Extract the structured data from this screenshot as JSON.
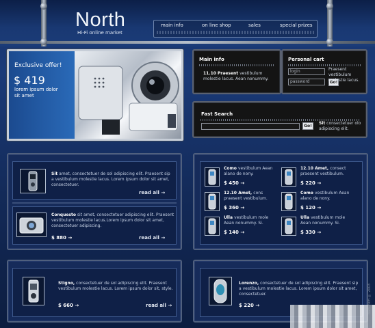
{
  "header": {
    "logo": "North",
    "tagline": "Hi-Fi online market",
    "nav": [
      "main info",
      "on line shop",
      "sales",
      "special prizes"
    ]
  },
  "offer": {
    "title": "Exclusive offer!",
    "price": "$ 419",
    "text": "lorem ipsum dolor sit amet"
  },
  "main_info": {
    "heading": "Main info",
    "date": "11.10",
    "strong": "Praesent",
    "text": "vestibulum molestie lacus. Aean nonummy."
  },
  "cart": {
    "heading": "Personal cart",
    "login_placeholder": "login",
    "password_placeholder": "password",
    "go": "Go!",
    "text": "Praesent vestibulum molestie lacus."
  },
  "search": {
    "heading": "Fast Search",
    "go": "Go!",
    "strong": "Sit",
    "text": "consectetuer olo adipiscing elit."
  },
  "left_products": [
    {
      "strong": "Sit",
      "text": "amet, consectetuer de sol adipiscing elit. Praesent sip a vestibulum molestie lacus. Lorem ipsum dolor sit amet, consectetuer.",
      "link": "read all"
    },
    {
      "strong": "Conquesto",
      "text": "sit amet, consectetuer adipiscing elit. Praesent vestibulum molestie lacus.Lorem ipsum dolor sit amet, consectetuer adipiscing.",
      "price": "$ 880",
      "link": "read all"
    }
  ],
  "phones": [
    {
      "title": "Como",
      "rest": "vestibulum Aean alano de nony.",
      "price": "$ 450"
    },
    {
      "title": "12.10 Amet,",
      "rest": "consect praesent vestibulum.",
      "price": "$ 220"
    },
    {
      "title": "12.10 Amet,",
      "rest": "cons praesent vestibulum.",
      "price": "$ 360"
    },
    {
      "title": "Como",
      "rest": "vestibulum Aean alano de nony.",
      "price": "$ 120"
    },
    {
      "title": "Ulla",
      "rest": "vestibulum mole Aean nonummy. Si.",
      "price": "$ 140"
    },
    {
      "title": "Ulla",
      "rest": "vestibulum mole Aean nonummy. Si.",
      "price": "$ 330"
    }
  ],
  "bottom_products": [
    {
      "strong": "Stigno,",
      "text": "consectetuer de sol adipiscing elit. Praesent vestibulum molestie lacus. Lorem ipsum dolor sit, style.",
      "price": "$ 660",
      "link": "read all"
    },
    {
      "strong": "Lorenzo,",
      "text": "consectetuer de sol adipiscing elit. Praesent sip a vestibulum molestie lacus. Lorem ipsum dolor sit amet, consectetuer.",
      "price": "$ 220"
    }
  ],
  "arrow": "→",
  "side_text": "bars.com © 2003",
  "colors": {
    "accent": "#1f4a94",
    "panel_dark": "#141414",
    "box": "#162b5a"
  }
}
